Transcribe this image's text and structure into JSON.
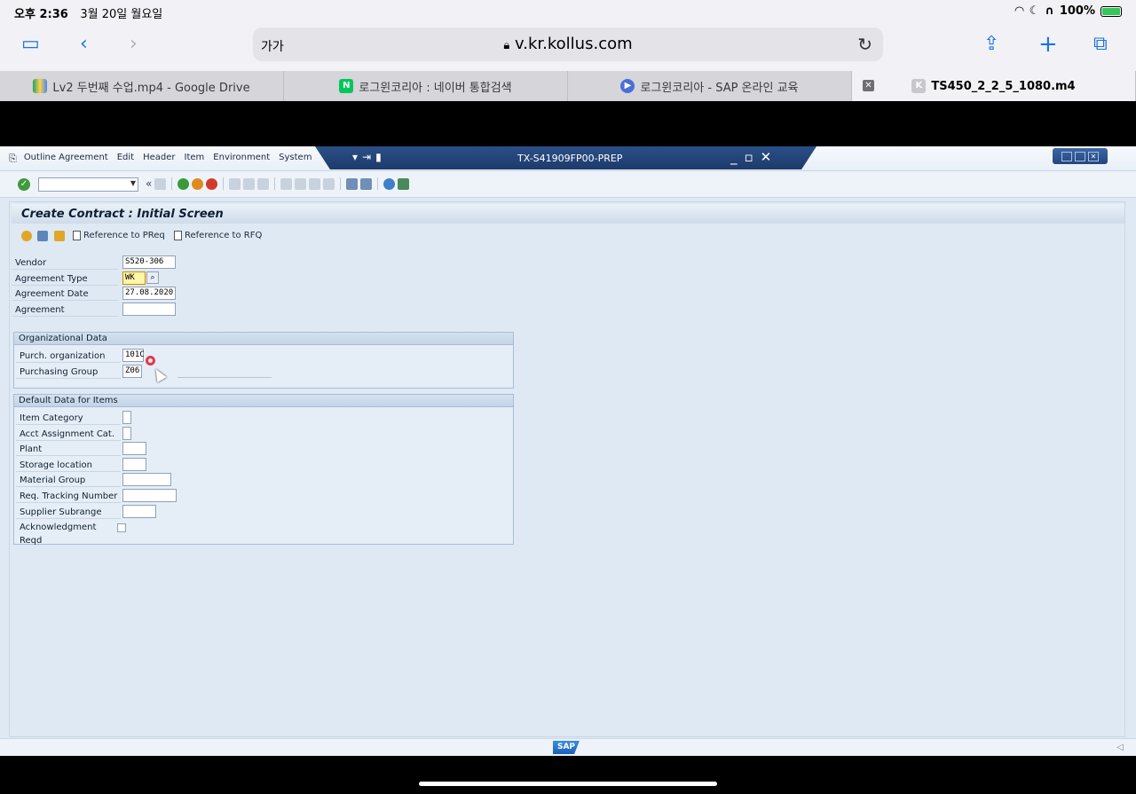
{
  "status_bar": {
    "time": "오후 2:36",
    "date": "3월 20일 월요일",
    "battery": "100%"
  },
  "browser": {
    "reader_label": "가가",
    "url": "v.kr.kollus.com",
    "tabs": [
      {
        "label": "Lv2 두번째 수업.mp4 - Google Drive",
        "icon": "google-drive-icon"
      },
      {
        "label": "로그윈코리아 : 네이버 통합검색",
        "icon": "naver-icon"
      },
      {
        "label": "로그윈코리아 - SAP 온라인 교육",
        "icon": "play-icon"
      },
      {
        "label": "TS450_2_2_5_1080.m4",
        "icon": "k-icon",
        "active": true
      }
    ]
  },
  "sap": {
    "menu": [
      "Outline Agreement",
      "Edit",
      "Header",
      "Item",
      "Environment",
      "System"
    ],
    "window_title": "TX-S41909FP00-PREP",
    "screen_title": "Create Contract : Initial Screen",
    "app_toolbar": {
      "ref_preq": "Reference to PReq",
      "ref_rfq": "Reference to RFQ"
    },
    "fields": {
      "vendor_label": "Vendor",
      "vendor_value": "S520-306",
      "agreement_type_label": "Agreement Type",
      "agreement_type_value": "WK",
      "agreement_date_label": "Agreement Date",
      "agreement_date_value": "27.08.2020",
      "agreement_label": "Agreement",
      "agreement_value": ""
    },
    "org_data": {
      "header": "Organizational Data",
      "purch_org_label": "Purch. organization",
      "purch_org_value": "101C",
      "purch_group_label": "Purchasing Group",
      "purch_group_value": "Z06"
    },
    "default_data": {
      "header": "Default Data for Items",
      "item_category": "Item Category",
      "acct_assignment": "Acct Assignment Cat.",
      "plant": "Plant",
      "storage_location": "Storage location",
      "material_group": "Material Group",
      "req_tracking": "Req. Tracking Number",
      "supplier_subrange": "Supplier Subrange",
      "ack_reqd": "Acknowledgment Reqd"
    },
    "logo": "SAP"
  }
}
